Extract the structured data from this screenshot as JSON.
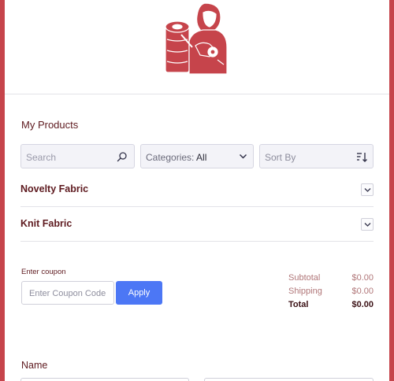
{
  "brand": {
    "accent": "#c6444b",
    "button": "#4c77f5",
    "heading": "#5e1a1f"
  },
  "logo": {
    "icon": "seamstress-fabric-roll-logo"
  },
  "products": {
    "title": "My Products",
    "search_placeholder": "Search",
    "categories_label": "Categories:",
    "categories_value": "All",
    "sort_label": "Sort By",
    "categories": [
      {
        "label": "Novelty Fabric"
      },
      {
        "label": "Knit Fabric"
      }
    ]
  },
  "coupon": {
    "label": "Enter coupon",
    "placeholder": "Enter Coupon Code",
    "apply_label": "Apply"
  },
  "totals": {
    "subtotal_label": "Subtotal",
    "subtotal_value": "$0.00",
    "shipping_label": "Shipping",
    "shipping_value": "$0.00",
    "total_label": "Total",
    "total_value": "$0.00"
  },
  "form": {
    "name_label": "Name"
  }
}
